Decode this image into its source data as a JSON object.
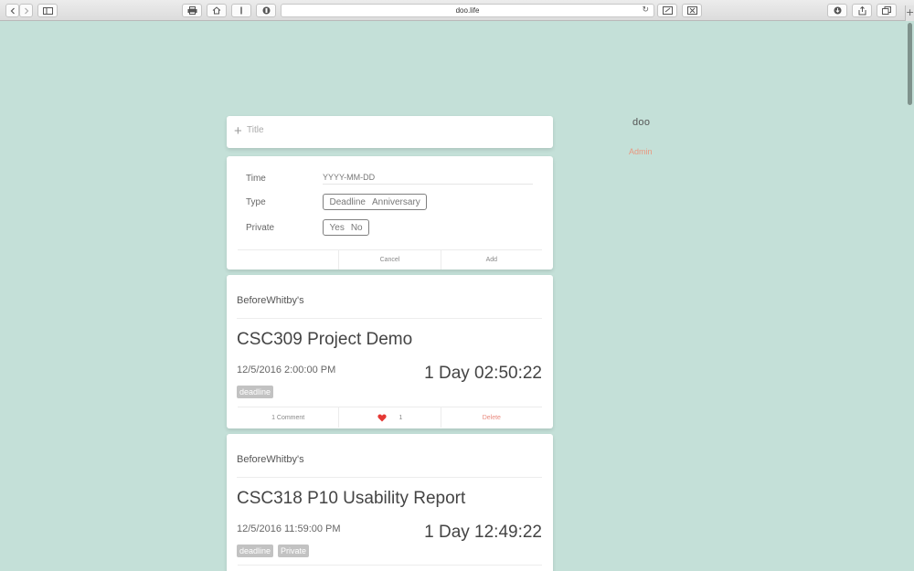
{
  "browser": {
    "url": "doo.life"
  },
  "sidebar": {
    "logo": "doo",
    "admin": "Admin"
  },
  "new_event": {
    "title_placeholder": "Title",
    "time_label": "Time",
    "time_placeholder": "YYYY-MM-DD",
    "type_label": "Type",
    "type_options": [
      "Deadline",
      "Anniversary"
    ],
    "private_label": "Private",
    "private_options": [
      "Yes",
      "No"
    ],
    "cancel": "Cancel",
    "add": "Add"
  },
  "events": [
    {
      "author": "BeforeWhitby's",
      "title": "CSC309 Project Demo",
      "date": "12/5/2016 2:00:00 PM",
      "countdown": "1 Day 02:50:22",
      "tags": [
        "deadline"
      ],
      "comments": "1 Comment",
      "likes": "1",
      "delete": "Delete"
    },
    {
      "author": "BeforeWhitby's",
      "title": "CSC318 P10 Usability Report",
      "date": "12/5/2016 11:59:00 PM",
      "countdown": "1 Day 12:49:22",
      "tags": [
        "deadline",
        "Private"
      ]
    }
  ],
  "colors": {
    "background": "#c4e0d8",
    "accent": "#e9977f",
    "heart": "#e53935"
  }
}
